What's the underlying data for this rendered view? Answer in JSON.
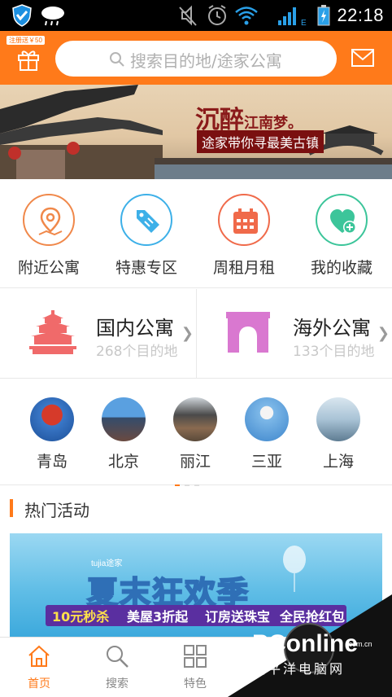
{
  "status_bar": {
    "time": "22:18"
  },
  "header": {
    "gift_badge": "注册送￥50",
    "search_placeholder": "搜索目的地/途家公寓"
  },
  "banner": {
    "title_main": "沉醉",
    "title_small": "江南梦。",
    "subtitle": "途家带你寻最美古镇"
  },
  "quick_links": [
    {
      "label": "附近公寓",
      "icon": "map-pin-icon",
      "color": "#f0884a"
    },
    {
      "label": "特惠专区",
      "icon": "price-tag-icon",
      "color": "#3db0e8"
    },
    {
      "label": "周租月租",
      "icon": "calendar-icon",
      "color": "#f06a4a"
    },
    {
      "label": "我的收藏",
      "icon": "heart-plus-icon",
      "color": "#3cc59a"
    }
  ],
  "regions": [
    {
      "title": "国内公寓",
      "count": "268个目的地",
      "icon": "temple-icon"
    },
    {
      "title": "海外公寓",
      "count": "133个目的地",
      "icon": "arch-icon"
    }
  ],
  "cities": [
    "青岛",
    "北京",
    "丽江",
    "三亚",
    "上海"
  ],
  "hot": {
    "title": "热门活动",
    "promo": {
      "brand": "tujia途家",
      "headline": "夏末狂欢季",
      "strip": [
        "10元秒杀",
        "美屋3折起",
        "订房送珠宝",
        "全民抢红包"
      ]
    }
  },
  "tabs": [
    {
      "label": "首页",
      "icon": "home-icon",
      "active": true
    },
    {
      "label": "搜索",
      "icon": "search-icon",
      "active": false
    },
    {
      "label": "特色",
      "icon": "grid-icon",
      "active": false
    }
  ],
  "watermark": {
    "logo": "PConline",
    "cn": "太平洋电脑网",
    "domain": ".com.cn"
  },
  "colors": {
    "accent": "#ff7a1a"
  }
}
